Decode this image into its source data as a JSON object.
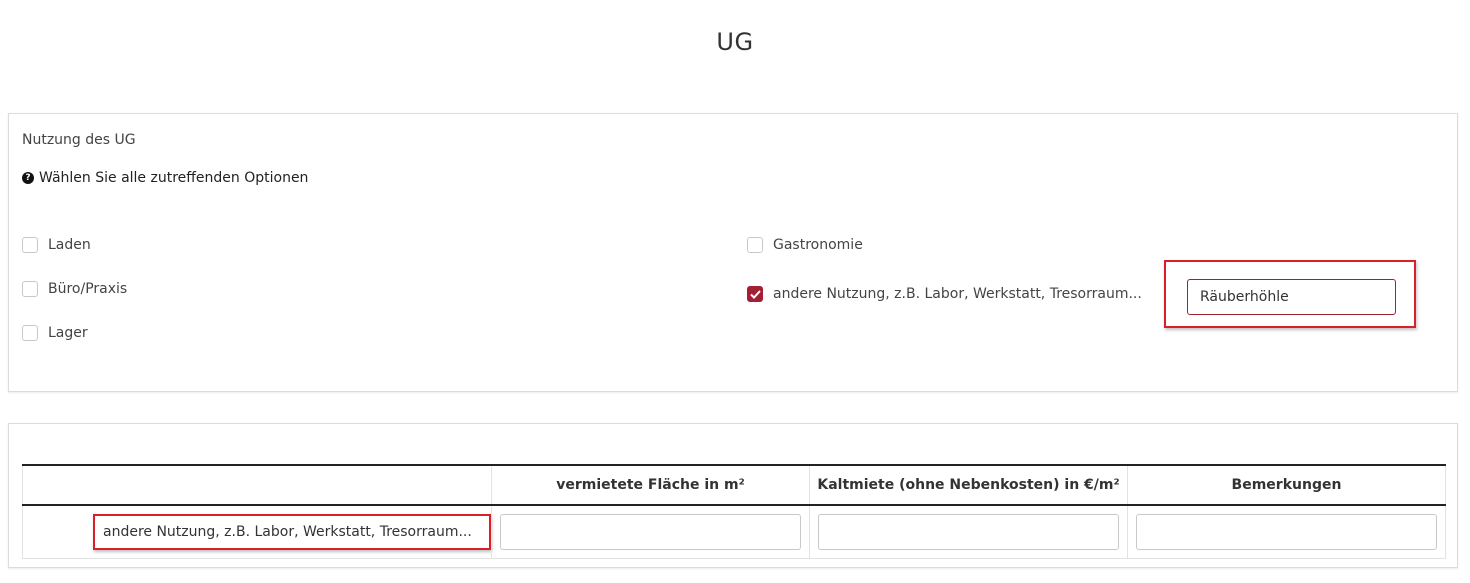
{
  "title": "UG",
  "usage_panel": {
    "label": "Nutzung des UG",
    "hint_icon": "question-circle",
    "hint": "Wählen Sie alle zutreffenden Optionen",
    "options_left": [
      {
        "label": "Laden",
        "checked": false
      },
      {
        "label": "Büro/Praxis",
        "checked": false
      },
      {
        "label": "Lager",
        "checked": false
      }
    ],
    "options_right": [
      {
        "label": "Gastronomie",
        "checked": false
      },
      {
        "label": "andere Nutzung, z.B. Labor, Werkstatt, Tresorraum...",
        "checked": true
      }
    ],
    "other_input_value": "Räuberhöhle",
    "accent_color": "#a31f34",
    "highlight_color": "#d91f2a"
  },
  "table": {
    "headers": [
      "",
      "vermietete Fläche in m²",
      "Kaltmiete (ohne Nebenkosten) in €/m²",
      "Bemerkungen"
    ],
    "rows": [
      {
        "label": "andere Nutzung, z.B. Labor, Werkstatt, Tresorraum...",
        "values": [
          "",
          "",
          ""
        ]
      }
    ]
  }
}
